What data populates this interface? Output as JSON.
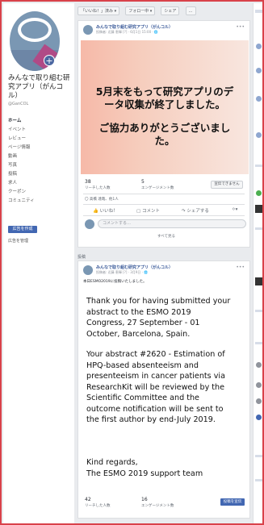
{
  "sidebar": {
    "page_name": "みんなで取り組む研究アプリ（がんコル）",
    "handle": "@GanCOL",
    "nav": [
      "ホーム",
      "イベント",
      "レビュー",
      "ページ情報",
      "動画",
      "写真",
      "投稿",
      "求人",
      "クーポン",
      "コミュニティ"
    ],
    "cta_label": "広告を作成",
    "manage_label": "広告を管理"
  },
  "topbar": {
    "like": "「いいね！」済み ▾",
    "follow": "フォロー中 ▾",
    "share": "シェア",
    "more": "…"
  },
  "post1": {
    "author": "みんなで取り組む研究アプリ（がんコル）",
    "meta": "投稿者: 近藤 恵輝 [?] · 6月1日 15:00 · 🌐",
    "announce": [
      "5月末をもって研究アプリのデ",
      "ータ収集が終了しました。",
      "",
      "ご協力ありがとうございまし",
      "た。"
    ],
    "reach_value": "38",
    "reach_label": "リーチした人数",
    "engage_value": "5",
    "engage_label": "エンゲージメント数",
    "boost_label": "宣伝できません",
    "reactions": "〇 高橋 達哉、他1人",
    "like_action": "いいね！",
    "comment_action": "コメント",
    "share_action": "シェアする",
    "comment_placeholder": "コメントする…",
    "see_all": "すべて見る"
  },
  "shared_label": "投稿",
  "post2": {
    "author": "みんなで取り組む研究アプリ（がんコル）",
    "meta": "投稿者: 近藤 恵輝 [?] · 3月9日 · 🌐",
    "jp_line": "本日ESMO2019に投稿いたしました。",
    "para1": [
      "Thank you for having submitted your",
      "abstract to the ESMO 2019",
      "Congress, 27 September - 01",
      "October, Barcelona, Spain."
    ],
    "para2": [
      "Your abstract #2620 - Estimation of",
      "HPQ-based absenteeism and",
      "presenteeism in cancer patients via",
      "ResearchKit  will be reviewed by the",
      "Scientific Committee and the",
      "outcome notification will be sent to",
      "the first author by end-July 2019."
    ],
    "para3": [
      "Kind regards,",
      "The ESMO 2019 support team"
    ],
    "reach_value": "42",
    "reach_label": "リーチした人数",
    "engage_value": "16",
    "engage_label": "エンゲージメント数",
    "boost_label": "投稿を宣伝"
  },
  "colors": {
    "frame": "#d9424a",
    "brand_blue": "#4267b2",
    "gradient_left": "#f6b9a8",
    "gradient_right": "#f8e6df"
  }
}
